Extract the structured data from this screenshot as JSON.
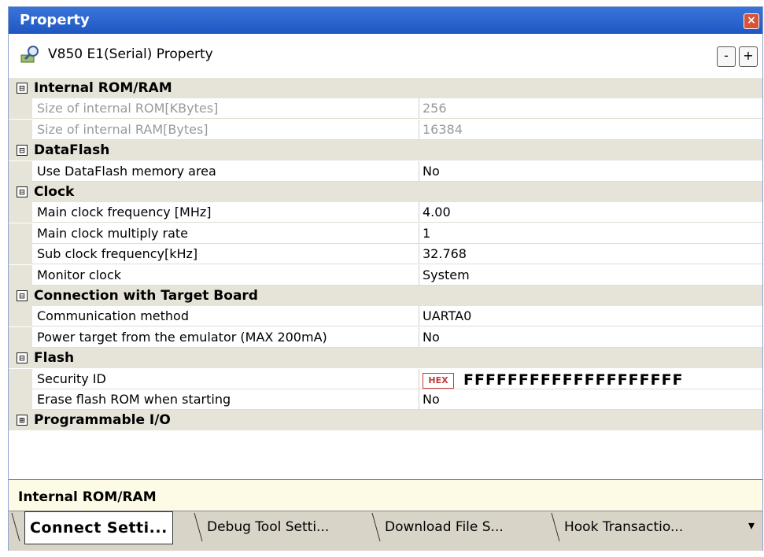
{
  "window": {
    "title": "Property",
    "close_icon": "close-icon"
  },
  "header": {
    "title": "V850 E1(Serial) Property",
    "collapse_label": "-",
    "expand_label": "+"
  },
  "categories": [
    {
      "label": "Internal ROM/RAM",
      "toggle": "⊟",
      "props": [
        {
          "name": "Size of internal ROM[KBytes]",
          "value": "256",
          "disabled": true
        },
        {
          "name": "Size of internal RAM[Bytes]",
          "value": "16384",
          "disabled": true
        }
      ]
    },
    {
      "label": "DataFlash",
      "toggle": "⊟",
      "props": [
        {
          "name": "Use DataFlash memory area",
          "value": "No"
        }
      ]
    },
    {
      "label": "Clock",
      "toggle": "⊟",
      "props": [
        {
          "name": "Main clock frequency [MHz]",
          "value": "4.00"
        },
        {
          "name": "Main clock multiply rate",
          "value": "1"
        },
        {
          "name": "Sub clock frequency[kHz]",
          "value": "32.768"
        },
        {
          "name": "Monitor clock",
          "value": "System"
        }
      ]
    },
    {
      "label": "Connection with Target Board",
      "toggle": "⊟",
      "props": [
        {
          "name": "Communication method",
          "value": "UARTA0"
        },
        {
          "name": "Power target from the emulator (MAX 200mA)",
          "value": "No"
        }
      ]
    },
    {
      "label": "Flash",
      "toggle": "⊟",
      "props": [
        {
          "name": "Security ID",
          "value": "FFFFFFFFFFFFFFFFFFFF",
          "hex_badge": "HEX"
        },
        {
          "name": "Erase flash ROM when starting",
          "value": "No"
        }
      ]
    },
    {
      "label": "Programmable I/O",
      "toggle": "⊞",
      "props": []
    }
  ],
  "description": {
    "text": "Internal ROM/RAM"
  },
  "tabs": [
    {
      "label": "Connect Setti...",
      "active": true
    },
    {
      "label": "Debug Tool Setti...",
      "active": false
    },
    {
      "label": "Download File S...",
      "active": false
    },
    {
      "label": "Hook Transactio...",
      "active": false
    }
  ],
  "tab_overflow": "▾"
}
